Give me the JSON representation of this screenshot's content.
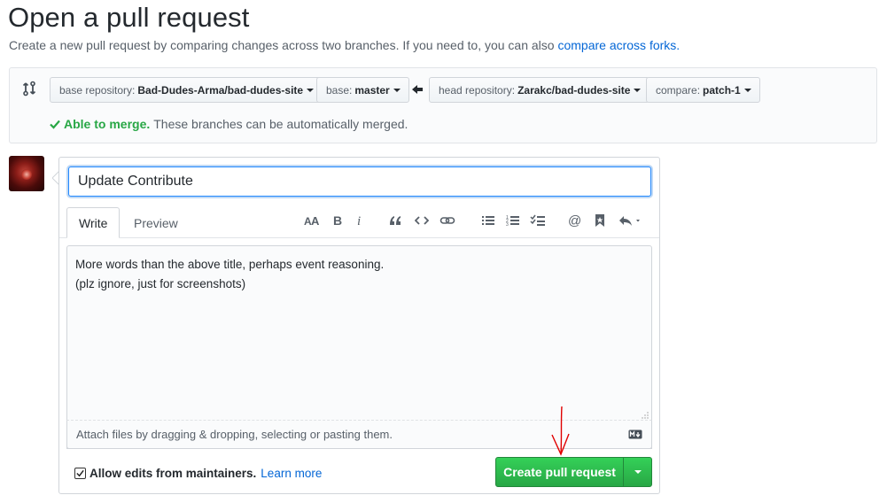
{
  "header": {
    "title": "Open a pull request",
    "subtitle": "Create a new pull request by comparing changes across two branches. If you need to, you can also",
    "subtitle_link": "compare across forks."
  },
  "range": {
    "base_repo_label": "base repository:",
    "base_repo_value": "Bad-Dudes-Arma/bad-dudes-site",
    "base_label": "base:",
    "base_value": "master",
    "head_repo_label": "head repository:",
    "head_repo_value": "Zarakc/bad-dudes-site",
    "compare_label": "compare:",
    "compare_value": "patch-1",
    "merge_ok": "Able to merge.",
    "merge_text": "These branches can be automatically merged."
  },
  "form": {
    "title_value": "Update Contribute",
    "tabs": [
      "Write",
      "Preview"
    ],
    "body_lines": [
      "More words than the above title, perhaps event reasoning.",
      "(plz ignore, just for screenshots)"
    ],
    "attach_text": "Attach files by dragging & dropping, selecting or pasting them.",
    "maintainers_label": "Allow edits from maintainers.",
    "learn_more": "Learn more",
    "submit_label": "Create pull request"
  },
  "toolbar": {
    "icons": [
      "header-icon",
      "bold-icon",
      "italic-icon",
      "quote-icon",
      "code-icon",
      "link-icon",
      "unordered-list-icon",
      "ordered-list-icon",
      "task-list-icon",
      "mention-icon",
      "saved-reply-icon",
      "reply-icon"
    ]
  },
  "colors": {
    "accent": "#0366d6",
    "success": "#28a745",
    "annotation": "#e00000"
  }
}
